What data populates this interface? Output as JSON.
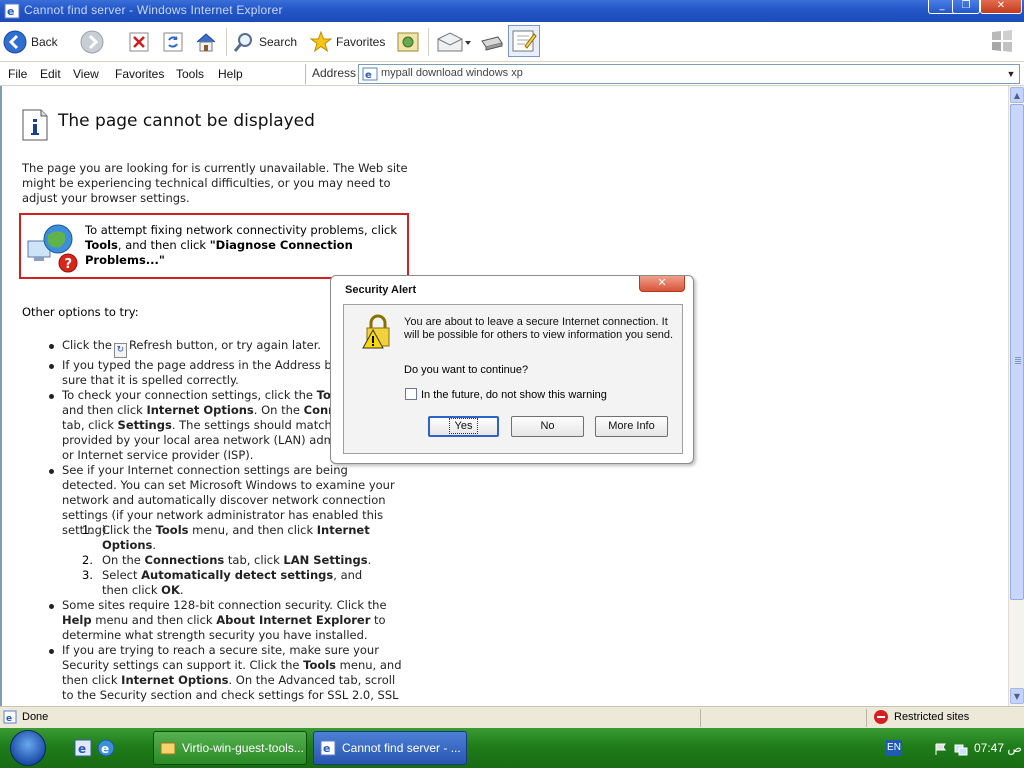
{
  "window": {
    "title": "Cannot find server - Windows Internet Explorer",
    "minimize": "_",
    "restore": "❐",
    "close": "✕"
  },
  "toolbar": {
    "back_label": "Back",
    "search_label": "Search",
    "favorites_label": "Favorites"
  },
  "menu": [
    "File",
    "Edit",
    "View",
    "Favorites",
    "Tools",
    "Help"
  ],
  "address": {
    "label": "Address",
    "value": "mypall download windows xp"
  },
  "page": {
    "heading": "The page cannot be displayed",
    "intro": "The page you are looking for is currently unavailable. The Web site might be experiencing technical difficulties, or you may need to adjust your browser settings.",
    "diag_pre": "To attempt fixing network connectivity problems, click ",
    "diag_tools": "Tools",
    "diag_mid": ", and then click ",
    "diag_link": "\"Diagnose Connection Problems...\"",
    "options_label": "Other options to try:",
    "bullet1_pre": "Click the",
    "bullet1_post": "Refresh button, or try again later.",
    "bullet2": "If you typed the page address in the Address bar, make sure that it is spelled correctly.",
    "bullet3_a": "To check your connection settings, click the ",
    "bullet3_b": "Tools",
    "bullet3_c": " menu, and then click ",
    "bullet3_d": "Internet Options",
    "bullet3_e": ". On the ",
    "bullet3_f": "Connections",
    "bullet3_g": " tab, click ",
    "bullet3_h": "Settings",
    "bullet3_i": ". The settings should match those provided by your local area network (LAN) administrator or Internet service provider (ISP).",
    "bullet4": "See if your Internet connection settings are being detected. You can set Microsoft Windows to examine your network and automatically discover network connection settings (if your network administrator has enabled this setting).",
    "step1_a": "Click the ",
    "step1_b": "Tools",
    "step1_c": " menu, and then click ",
    "step1_d": "Internet Options",
    "step1_e": ".",
    "step2_a": "On the ",
    "step2_b": "Connections",
    "step2_c": " tab, click ",
    "step2_d": "LAN Settings",
    "step2_e": ".",
    "step3_a": "Select ",
    "step3_b": "Automatically detect settings",
    "step3_c": ", and then click ",
    "step3_d": "OK",
    "step3_e": ".",
    "bullet5_a": "Some sites require 128-bit connection security. Click the ",
    "bullet5_b": "Help",
    "bullet5_c": " menu and then click ",
    "bullet5_d": "About Internet Explorer",
    "bullet5_e": " to determine what strength security you have installed.",
    "bullet6_a": "If you are trying to reach a secure site, make sure your Security settings can support it. Click the ",
    "bullet6_b": "Tools",
    "bullet6_c": " menu, and then click ",
    "bullet6_d": "Internet Options",
    "bullet6_e": ". On the Advanced tab, scroll to the Security section and check settings for SSL 2.0, SSL"
  },
  "dialog": {
    "title": "Security Alert",
    "close": "✕",
    "message": "You are about to leave a secure Internet connection.  It will be possible for others to view information you send.",
    "question": "Do you want to continue?",
    "checkbox_label": "In the future, do not show this warning",
    "yes": "Yes",
    "no": "No",
    "more_info": "More Info"
  },
  "status": {
    "text": "Done",
    "zone": "Restricted sites"
  },
  "taskbar": {
    "task1": "Virtio-win-guest-tools...",
    "task2": "Cannot find server - ...",
    "lang": "EN",
    "time": "07:47 ص"
  }
}
